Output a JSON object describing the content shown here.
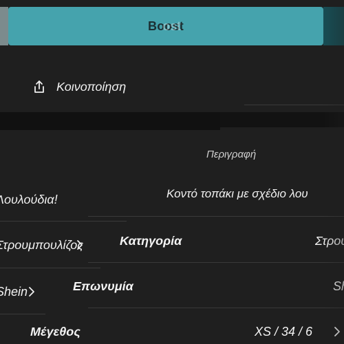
{
  "top_bar": {
    "boost_label": "Boost",
    "boost_ghost": "ost"
  },
  "share": {
    "label": "Κοινοποίηση",
    "icon": "share-up-icon"
  },
  "section": {
    "title": "Περιγραφή"
  },
  "description": {
    "left_text": "Λουλούδια!",
    "right_text": "Κοντό τοπάκι με σχέδιο λου"
  },
  "rows": [
    {
      "left_text": "Στρουμπουλίζος",
      "label": "Κατηγορία",
      "value": "Στρουμπουλίζ"
    },
    {
      "left_text": "Shein",
      "label": "Επωνυμία",
      "value": "Sh"
    },
    {
      "left_text": "",
      "label": "Μέγεθος",
      "value": "XS / 34 / 6"
    }
  ],
  "colors": {
    "accent": "#45a3ad",
    "background": "#1f1f1f",
    "text": "#f1f1f1",
    "divider": "#3a3a3a"
  }
}
